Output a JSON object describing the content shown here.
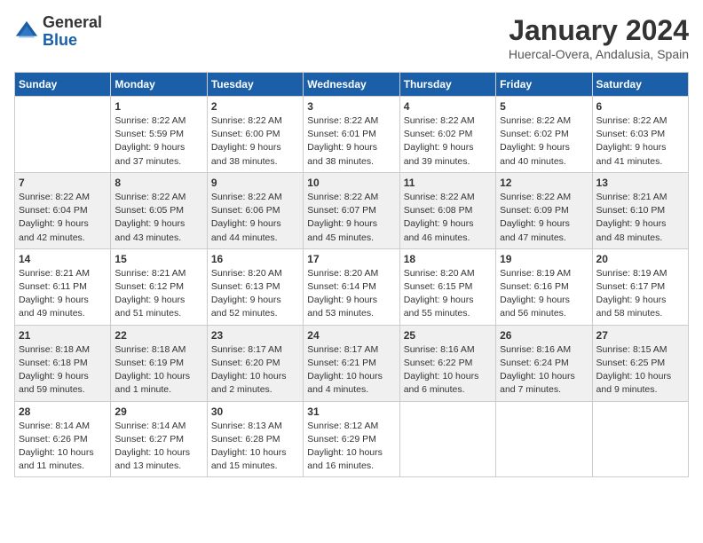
{
  "header": {
    "logo_general": "General",
    "logo_blue": "Blue",
    "month_title": "January 2024",
    "location": "Huercal-Overa, Andalusia, Spain"
  },
  "columns": [
    "Sunday",
    "Monday",
    "Tuesday",
    "Wednesday",
    "Thursday",
    "Friday",
    "Saturday"
  ],
  "weeks": [
    [
      {
        "day": "",
        "info": ""
      },
      {
        "day": "1",
        "info": "Sunrise: 8:22 AM\nSunset: 5:59 PM\nDaylight: 9 hours\nand 37 minutes."
      },
      {
        "day": "2",
        "info": "Sunrise: 8:22 AM\nSunset: 6:00 PM\nDaylight: 9 hours\nand 38 minutes."
      },
      {
        "day": "3",
        "info": "Sunrise: 8:22 AM\nSunset: 6:01 PM\nDaylight: 9 hours\nand 38 minutes."
      },
      {
        "day": "4",
        "info": "Sunrise: 8:22 AM\nSunset: 6:02 PM\nDaylight: 9 hours\nand 39 minutes."
      },
      {
        "day": "5",
        "info": "Sunrise: 8:22 AM\nSunset: 6:02 PM\nDaylight: 9 hours\nand 40 minutes."
      },
      {
        "day": "6",
        "info": "Sunrise: 8:22 AM\nSunset: 6:03 PM\nDaylight: 9 hours\nand 41 minutes."
      }
    ],
    [
      {
        "day": "7",
        "info": "Sunrise: 8:22 AM\nSunset: 6:04 PM\nDaylight: 9 hours\nand 42 minutes."
      },
      {
        "day": "8",
        "info": "Sunrise: 8:22 AM\nSunset: 6:05 PM\nDaylight: 9 hours\nand 43 minutes."
      },
      {
        "day": "9",
        "info": "Sunrise: 8:22 AM\nSunset: 6:06 PM\nDaylight: 9 hours\nand 44 minutes."
      },
      {
        "day": "10",
        "info": "Sunrise: 8:22 AM\nSunset: 6:07 PM\nDaylight: 9 hours\nand 45 minutes."
      },
      {
        "day": "11",
        "info": "Sunrise: 8:22 AM\nSunset: 6:08 PM\nDaylight: 9 hours\nand 46 minutes."
      },
      {
        "day": "12",
        "info": "Sunrise: 8:22 AM\nSunset: 6:09 PM\nDaylight: 9 hours\nand 47 minutes."
      },
      {
        "day": "13",
        "info": "Sunrise: 8:21 AM\nSunset: 6:10 PM\nDaylight: 9 hours\nand 48 minutes."
      }
    ],
    [
      {
        "day": "14",
        "info": "Sunrise: 8:21 AM\nSunset: 6:11 PM\nDaylight: 9 hours\nand 49 minutes."
      },
      {
        "day": "15",
        "info": "Sunrise: 8:21 AM\nSunset: 6:12 PM\nDaylight: 9 hours\nand 51 minutes."
      },
      {
        "day": "16",
        "info": "Sunrise: 8:20 AM\nSunset: 6:13 PM\nDaylight: 9 hours\nand 52 minutes."
      },
      {
        "day": "17",
        "info": "Sunrise: 8:20 AM\nSunset: 6:14 PM\nDaylight: 9 hours\nand 53 minutes."
      },
      {
        "day": "18",
        "info": "Sunrise: 8:20 AM\nSunset: 6:15 PM\nDaylight: 9 hours\nand 55 minutes."
      },
      {
        "day": "19",
        "info": "Sunrise: 8:19 AM\nSunset: 6:16 PM\nDaylight: 9 hours\nand 56 minutes."
      },
      {
        "day": "20",
        "info": "Sunrise: 8:19 AM\nSunset: 6:17 PM\nDaylight: 9 hours\nand 58 minutes."
      }
    ],
    [
      {
        "day": "21",
        "info": "Sunrise: 8:18 AM\nSunset: 6:18 PM\nDaylight: 9 hours\nand 59 minutes."
      },
      {
        "day": "22",
        "info": "Sunrise: 8:18 AM\nSunset: 6:19 PM\nDaylight: 10 hours\nand 1 minute."
      },
      {
        "day": "23",
        "info": "Sunrise: 8:17 AM\nSunset: 6:20 PM\nDaylight: 10 hours\nand 2 minutes."
      },
      {
        "day": "24",
        "info": "Sunrise: 8:17 AM\nSunset: 6:21 PM\nDaylight: 10 hours\nand 4 minutes."
      },
      {
        "day": "25",
        "info": "Sunrise: 8:16 AM\nSunset: 6:22 PM\nDaylight: 10 hours\nand 6 minutes."
      },
      {
        "day": "26",
        "info": "Sunrise: 8:16 AM\nSunset: 6:24 PM\nDaylight: 10 hours\nand 7 minutes."
      },
      {
        "day": "27",
        "info": "Sunrise: 8:15 AM\nSunset: 6:25 PM\nDaylight: 10 hours\nand 9 minutes."
      }
    ],
    [
      {
        "day": "28",
        "info": "Sunrise: 8:14 AM\nSunset: 6:26 PM\nDaylight: 10 hours\nand 11 minutes."
      },
      {
        "day": "29",
        "info": "Sunrise: 8:14 AM\nSunset: 6:27 PM\nDaylight: 10 hours\nand 13 minutes."
      },
      {
        "day": "30",
        "info": "Sunrise: 8:13 AM\nSunset: 6:28 PM\nDaylight: 10 hours\nand 15 minutes."
      },
      {
        "day": "31",
        "info": "Sunrise: 8:12 AM\nSunset: 6:29 PM\nDaylight: 10 hours\nand 16 minutes."
      },
      {
        "day": "",
        "info": ""
      },
      {
        "day": "",
        "info": ""
      },
      {
        "day": "",
        "info": ""
      }
    ]
  ]
}
